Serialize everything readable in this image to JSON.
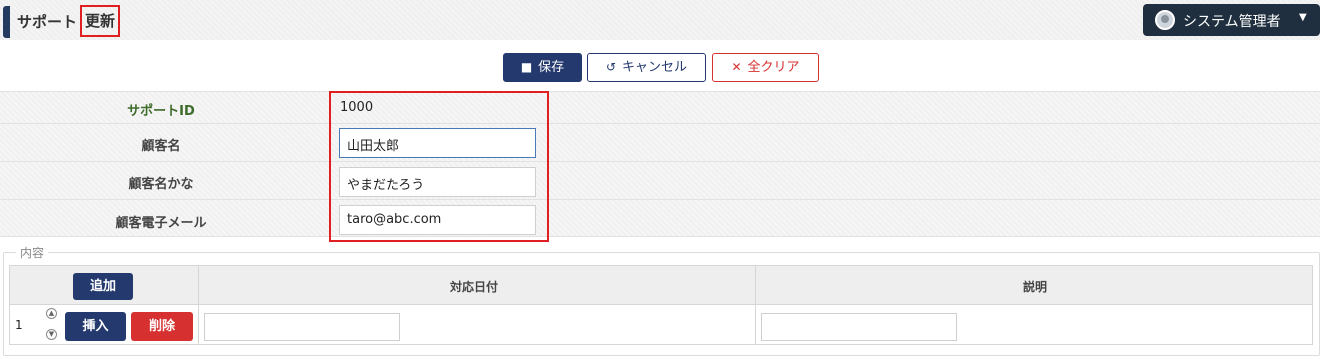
{
  "header": {
    "title": "サポート",
    "title_mode": "更新",
    "user_label": "システム管理者"
  },
  "toolbar": {
    "save_label": "保存",
    "cancel_label": "キャンセル",
    "clear_label": "全クリア"
  },
  "form": {
    "support_id_label": "サポートID",
    "support_id_value": "1000",
    "customer_name_label": "顧客名",
    "customer_name_value": "山田太郎",
    "customer_kana_label": "顧客名かな",
    "customer_kana_value": "やまだたろう",
    "customer_email_label": "顧客電子メール",
    "customer_email_value": "taro@abc.com"
  },
  "content": {
    "legend": "内容",
    "add_label": "追加",
    "columns": [
      "対応日付",
      "説明"
    ],
    "rows": [
      {
        "num": "1",
        "insert_label": "挿入",
        "delete_label": "削除",
        "date": "",
        "description": ""
      }
    ]
  },
  "colors": {
    "primary": "#243a6e",
    "danger": "#d63030",
    "highlight": "#e02020",
    "label_green": "#3d6b2a"
  }
}
